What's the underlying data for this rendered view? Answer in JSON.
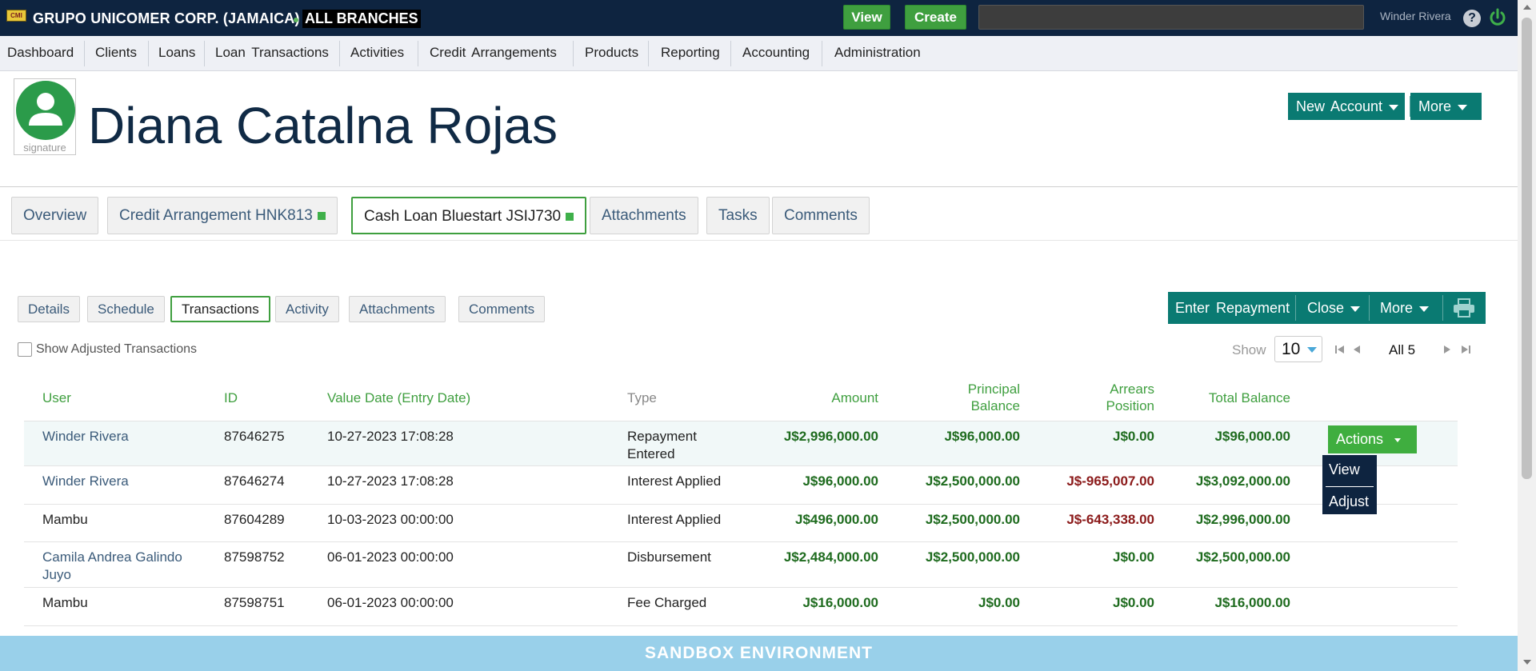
{
  "topbar": {
    "logo_text": "CMI",
    "org_name": "GRUPO UNICOMER CORP. (JAMAICA)",
    "branch": "ALL BRANCHES",
    "view_button": "View",
    "create_button": "Create",
    "search_value": "",
    "user_name": "Winder Rivera",
    "help_label": "?"
  },
  "nav": [
    "Dashboard",
    "Clients",
    "Loans",
    "Loan Transactions",
    "Activities",
    "Credit Arrangements",
    "Products",
    "Reporting",
    "Accounting",
    "Administration"
  ],
  "client": {
    "name": "Diana Catalna Rojas",
    "avatar_caption": "signature",
    "new_account_button": "New Account",
    "more_button": "More"
  },
  "tabs": [
    {
      "label": "Overview",
      "marker": false
    },
    {
      "label": "Credit Arrangement HNK813",
      "marker": true
    },
    {
      "label": "Cash Loan Bluestart JSIJ730",
      "marker": true,
      "active": true
    },
    {
      "label": "Attachments",
      "marker": false
    },
    {
      "label": "Tasks",
      "marker": false
    },
    {
      "label": "Comments",
      "marker": false
    }
  ],
  "subtabs": [
    {
      "label": "Details"
    },
    {
      "label": "Schedule"
    },
    {
      "label": "Transactions",
      "active": true
    },
    {
      "label": "Activity"
    },
    {
      "label": "Attachments"
    },
    {
      "label": "Comments"
    }
  ],
  "toolbar": {
    "enter_repayment": "Enter Repayment",
    "close": "Close",
    "more": "More"
  },
  "filters": {
    "show_adjusted_label": "Show Adjusted Transactions",
    "show_adjusted_checked": false,
    "show_label": "Show",
    "page_size": "10",
    "page_info": "All 5"
  },
  "table": {
    "headers": {
      "user": "User",
      "id": "ID",
      "value_date": "Value Date (Entry Date)",
      "type": "Type",
      "amount": "Amount",
      "principal_balance_1": "Principal",
      "principal_balance_2": "Balance",
      "arrears_position_1": "Arrears",
      "arrears_position_2": "Position",
      "total_balance": "Total Balance"
    },
    "rows": [
      {
        "user": "Winder Rivera",
        "user2": "",
        "id": "87646275",
        "date": "10-27-2023 17:08:28",
        "type": "Repayment",
        "type2": "Entered",
        "amount": "J$2,996,000.00",
        "principal": "J$96,000.00",
        "arrears": "J$0.00",
        "total": "J$96,000.00"
      },
      {
        "user": "Winder Rivera",
        "user2": "",
        "id": "87646274",
        "date": "10-27-2023 17:08:28",
        "type": "Interest Applied",
        "type2": "",
        "amount": "J$96,000.00",
        "principal": "J$2,500,000.00",
        "arrears": "J$-965,007.00",
        "total": "J$3,092,000.00"
      },
      {
        "user": "Mambu",
        "user2": "",
        "id": "87604289",
        "date": "10-03-2023 00:00:00",
        "type": "Interest Applied",
        "type2": "",
        "amount": "J$496,000.00",
        "principal": "J$2,500,000.00",
        "arrears": "J$-643,338.00",
        "total": "J$2,996,000.00"
      },
      {
        "user": "Camila Andrea Galindo",
        "user2": "Juyo",
        "id": "87598752",
        "date": "06-01-2023 00:00:00",
        "type": "Disbursement",
        "type2": "",
        "amount": "J$2,484,000.00",
        "principal": "J$2,500,000.00",
        "arrears": "J$0.00",
        "total": "J$2,500,000.00"
      },
      {
        "user": "Mambu",
        "user2": "",
        "id": "87598751",
        "date": "06-01-2023 00:00:00",
        "type": "Fee Charged",
        "type2": "",
        "amount": "J$16,000.00",
        "principal": "J$0.00",
        "arrears": "J$0.00",
        "total": "J$16,000.00"
      }
    ],
    "actions_button": "Actions",
    "actions_menu": [
      "View",
      "Adjust"
    ]
  },
  "footer": {
    "sandbox_banner": "SANDBOX ENVIRONMENT"
  },
  "colors": {
    "topbar": "#0e2440",
    "accent_green": "#3f9f3f",
    "teal": "#0a7a72",
    "sandbox": "#99d0ea",
    "negative": "#8b1a1a",
    "money": "#1e6b1e"
  }
}
